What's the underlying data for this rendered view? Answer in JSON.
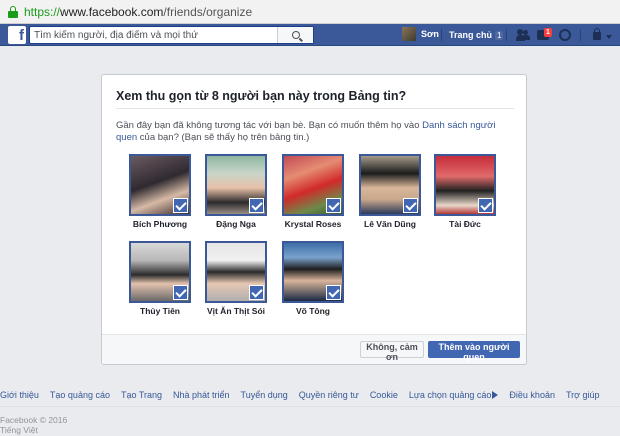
{
  "browser": {
    "url_scheme": "https://",
    "url_host": "www.facebook.com",
    "url_path": "/friends/organize"
  },
  "header": {
    "logo": "f",
    "search_placeholder": "Tìm kiếm người, địa điểm và mọi thứ",
    "user_name": "Sơn",
    "home_label": "Trang chủ",
    "home_count": "1",
    "messages_badge": "1"
  },
  "dialog": {
    "title": "Xem thu gọn từ 8 người bạn này trong Bảng tin?",
    "body_before": "Gần đây bạn đã không tương tác với bạn bè. Bạn có muốn thêm họ vào ",
    "body_link": "Danh sách người quen",
    "body_after": " của bạn? (Bạn sẽ thấy họ trên bảng tin.)",
    "friends": [
      {
        "name": "Bích Phương"
      },
      {
        "name": "Đặng Nga"
      },
      {
        "name": "Krystal Roses"
      },
      {
        "name": "Lê Văn Dũng"
      },
      {
        "name": "Tài Đức"
      },
      {
        "name": "Thủy Tiên"
      },
      {
        "name": "Vịt Ăn Thịt Sói"
      },
      {
        "name": "Võ Tông"
      }
    ],
    "cancel_label": "Không, cảm ơn",
    "confirm_label": "Thêm vào người quen"
  },
  "footer": {
    "links": [
      "Giới thiệu",
      "Tạo quảng cáo",
      "Tạo Trang",
      "Nhà phát triển",
      "Tuyển dụng",
      "Quyền riêng tư",
      "Cookie",
      "Lựa chọn quảng cáo",
      "Điều khoản",
      "Trợ giúp"
    ],
    "copyright": "Facebook © 2016",
    "language": "Tiếng Việt"
  },
  "colors": {
    "brand": "#3b5998",
    "primary_button": "#4267b2",
    "link": "#365899",
    "notification": "#fa3e3e"
  }
}
